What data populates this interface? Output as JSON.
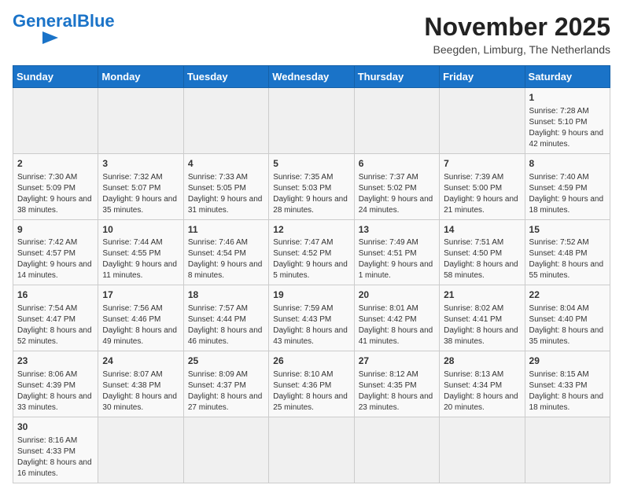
{
  "header": {
    "logo_general": "General",
    "logo_blue": "Blue",
    "month_title": "November 2025",
    "subtitle": "Beegden, Limburg, The Netherlands"
  },
  "weekdays": [
    "Sunday",
    "Monday",
    "Tuesday",
    "Wednesday",
    "Thursday",
    "Friday",
    "Saturday"
  ],
  "weeks": [
    [
      {
        "day": "",
        "empty": true
      },
      {
        "day": "",
        "empty": true
      },
      {
        "day": "",
        "empty": true
      },
      {
        "day": "",
        "empty": true
      },
      {
        "day": "",
        "empty": true
      },
      {
        "day": "",
        "empty": true
      },
      {
        "day": "1",
        "sunrise": "Sunrise: 7:28 AM",
        "sunset": "Sunset: 5:10 PM",
        "daylight": "Daylight: 9 hours and 42 minutes."
      }
    ],
    [
      {
        "day": "2",
        "sunrise": "Sunrise: 7:30 AM",
        "sunset": "Sunset: 5:09 PM",
        "daylight": "Daylight: 9 hours and 38 minutes."
      },
      {
        "day": "3",
        "sunrise": "Sunrise: 7:32 AM",
        "sunset": "Sunset: 5:07 PM",
        "daylight": "Daylight: 9 hours and 35 minutes."
      },
      {
        "day": "4",
        "sunrise": "Sunrise: 7:33 AM",
        "sunset": "Sunset: 5:05 PM",
        "daylight": "Daylight: 9 hours and 31 minutes."
      },
      {
        "day": "5",
        "sunrise": "Sunrise: 7:35 AM",
        "sunset": "Sunset: 5:03 PM",
        "daylight": "Daylight: 9 hours and 28 minutes."
      },
      {
        "day": "6",
        "sunrise": "Sunrise: 7:37 AM",
        "sunset": "Sunset: 5:02 PM",
        "daylight": "Daylight: 9 hours and 24 minutes."
      },
      {
        "day": "7",
        "sunrise": "Sunrise: 7:39 AM",
        "sunset": "Sunset: 5:00 PM",
        "daylight": "Daylight: 9 hours and 21 minutes."
      },
      {
        "day": "8",
        "sunrise": "Sunrise: 7:40 AM",
        "sunset": "Sunset: 4:59 PM",
        "daylight": "Daylight: 9 hours and 18 minutes."
      }
    ],
    [
      {
        "day": "9",
        "sunrise": "Sunrise: 7:42 AM",
        "sunset": "Sunset: 4:57 PM",
        "daylight": "Daylight: 9 hours and 14 minutes."
      },
      {
        "day": "10",
        "sunrise": "Sunrise: 7:44 AM",
        "sunset": "Sunset: 4:55 PM",
        "daylight": "Daylight: 9 hours and 11 minutes."
      },
      {
        "day": "11",
        "sunrise": "Sunrise: 7:46 AM",
        "sunset": "Sunset: 4:54 PM",
        "daylight": "Daylight: 9 hours and 8 minutes."
      },
      {
        "day": "12",
        "sunrise": "Sunrise: 7:47 AM",
        "sunset": "Sunset: 4:52 PM",
        "daylight": "Daylight: 9 hours and 5 minutes."
      },
      {
        "day": "13",
        "sunrise": "Sunrise: 7:49 AM",
        "sunset": "Sunset: 4:51 PM",
        "daylight": "Daylight: 9 hours and 1 minute."
      },
      {
        "day": "14",
        "sunrise": "Sunrise: 7:51 AM",
        "sunset": "Sunset: 4:50 PM",
        "daylight": "Daylight: 8 hours and 58 minutes."
      },
      {
        "day": "15",
        "sunrise": "Sunrise: 7:52 AM",
        "sunset": "Sunset: 4:48 PM",
        "daylight": "Daylight: 8 hours and 55 minutes."
      }
    ],
    [
      {
        "day": "16",
        "sunrise": "Sunrise: 7:54 AM",
        "sunset": "Sunset: 4:47 PM",
        "daylight": "Daylight: 8 hours and 52 minutes."
      },
      {
        "day": "17",
        "sunrise": "Sunrise: 7:56 AM",
        "sunset": "Sunset: 4:46 PM",
        "daylight": "Daylight: 8 hours and 49 minutes."
      },
      {
        "day": "18",
        "sunrise": "Sunrise: 7:57 AM",
        "sunset": "Sunset: 4:44 PM",
        "daylight": "Daylight: 8 hours and 46 minutes."
      },
      {
        "day": "19",
        "sunrise": "Sunrise: 7:59 AM",
        "sunset": "Sunset: 4:43 PM",
        "daylight": "Daylight: 8 hours and 43 minutes."
      },
      {
        "day": "20",
        "sunrise": "Sunrise: 8:01 AM",
        "sunset": "Sunset: 4:42 PM",
        "daylight": "Daylight: 8 hours and 41 minutes."
      },
      {
        "day": "21",
        "sunrise": "Sunrise: 8:02 AM",
        "sunset": "Sunset: 4:41 PM",
        "daylight": "Daylight: 8 hours and 38 minutes."
      },
      {
        "day": "22",
        "sunrise": "Sunrise: 8:04 AM",
        "sunset": "Sunset: 4:40 PM",
        "daylight": "Daylight: 8 hours and 35 minutes."
      }
    ],
    [
      {
        "day": "23",
        "sunrise": "Sunrise: 8:06 AM",
        "sunset": "Sunset: 4:39 PM",
        "daylight": "Daylight: 8 hours and 33 minutes."
      },
      {
        "day": "24",
        "sunrise": "Sunrise: 8:07 AM",
        "sunset": "Sunset: 4:38 PM",
        "daylight": "Daylight: 8 hours and 30 minutes."
      },
      {
        "day": "25",
        "sunrise": "Sunrise: 8:09 AM",
        "sunset": "Sunset: 4:37 PM",
        "daylight": "Daylight: 8 hours and 27 minutes."
      },
      {
        "day": "26",
        "sunrise": "Sunrise: 8:10 AM",
        "sunset": "Sunset: 4:36 PM",
        "daylight": "Daylight: 8 hours and 25 minutes."
      },
      {
        "day": "27",
        "sunrise": "Sunrise: 8:12 AM",
        "sunset": "Sunset: 4:35 PM",
        "daylight": "Daylight: 8 hours and 23 minutes."
      },
      {
        "day": "28",
        "sunrise": "Sunrise: 8:13 AM",
        "sunset": "Sunset: 4:34 PM",
        "daylight": "Daylight: 8 hours and 20 minutes."
      },
      {
        "day": "29",
        "sunrise": "Sunrise: 8:15 AM",
        "sunset": "Sunset: 4:33 PM",
        "daylight": "Daylight: 8 hours and 18 minutes."
      }
    ],
    [
      {
        "day": "30",
        "sunrise": "Sunrise: 8:16 AM",
        "sunset": "Sunset: 4:33 PM",
        "daylight": "Daylight: 8 hours and 16 minutes."
      },
      {
        "day": "",
        "empty": true
      },
      {
        "day": "",
        "empty": true
      },
      {
        "day": "",
        "empty": true
      },
      {
        "day": "",
        "empty": true
      },
      {
        "day": "",
        "empty": true
      },
      {
        "day": "",
        "empty": true
      }
    ]
  ]
}
